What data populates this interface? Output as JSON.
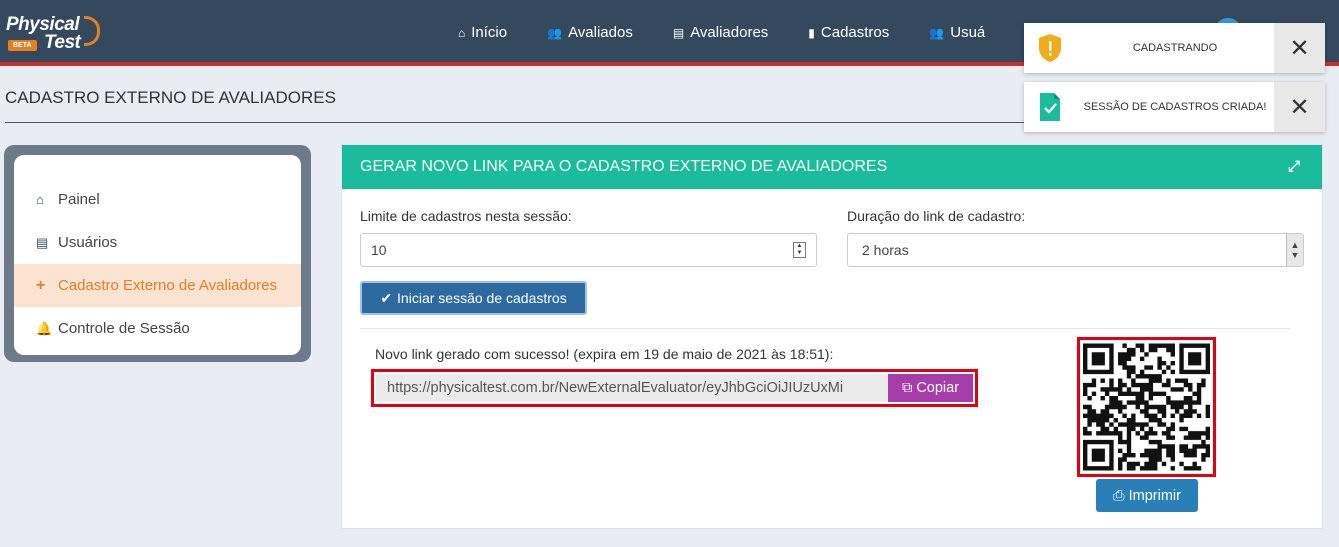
{
  "logo": {
    "line1": "Physical",
    "line2": "Test",
    "badge": "BETA"
  },
  "nav": [
    {
      "label": "Início",
      "icon": "home-icon",
      "glyph": "⌂"
    },
    {
      "label": "Avaliados",
      "icon": "users-icon",
      "glyph": "👥"
    },
    {
      "label": "Avaliadores",
      "icon": "id-card-icon",
      "glyph": "▤"
    },
    {
      "label": "Cadastros",
      "icon": "book-icon",
      "glyph": "▮"
    },
    {
      "label": "Usuá",
      "icon": "users-icon",
      "glyph": "👥"
    }
  ],
  "page_title": "CADASTRO EXTERNO DE AVALIADORES",
  "sidebar": {
    "items": [
      {
        "label": "Painel",
        "glyph": "⌂",
        "icon": "home-icon"
      },
      {
        "label": "Usuários",
        "glyph": "▤",
        "icon": "id-card-icon"
      },
      {
        "label": "Cadastro Externo de Avaliadores",
        "glyph": "+",
        "icon": "plus-icon",
        "active": true
      },
      {
        "label": "Controle de Sessão",
        "glyph": "🔔",
        "icon": "bell-icon"
      }
    ]
  },
  "panel": {
    "title": "GERAR NOVO LINK PARA O CADASTRO EXTERNO DE AVALIADORES",
    "limit_label": "Limite de cadastros nesta sessão:",
    "limit_value": "10",
    "duration_label": "Duração do link de cadastro:",
    "duration_value": "2 horas",
    "start_button": "Iniciar sessão de cadastros",
    "success_text": "Novo link gerado com sucesso! (expira em 19 de maio de 2021 às 18:51):",
    "link_url": "https://physicaltest.com.br/NewExternalEvaluator/eyJhbGciOiJIUzUxMi",
    "copy_button": "Copiar",
    "print_button": "Imprimir"
  },
  "toasts": [
    {
      "message": "CADASTRANDO",
      "type": "warning",
      "color": "#f0ad1b"
    },
    {
      "message": "SESSÃO DE CADASTROS CRIADA!",
      "type": "success",
      "color": "#1abc9c"
    }
  ],
  "colors": {
    "navbar": "#34495e",
    "accent_red": "#c9302c",
    "panel_header": "#1abc9c",
    "active_orange": "#e67e22",
    "copy_purple": "#a63ca8",
    "primary_blue": "#2c6aa0"
  }
}
